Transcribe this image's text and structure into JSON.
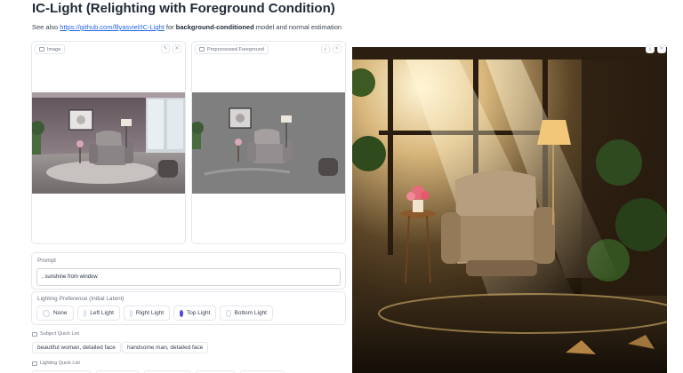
{
  "header": {
    "title": "IC-Light (Relighting with Foreground Condition)",
    "see_also_prefix": "See also ",
    "link_text": "https://github.com/lllyasviel/IC-Light",
    "see_also_middle": " for ",
    "see_also_bold": "background-conditioned",
    "see_also_suffix": " model and normal estimation"
  },
  "image_panel": {
    "label": "Image",
    "edit_icon": "pencil-icon",
    "close_icon": "close-icon"
  },
  "preprocessed_panel": {
    "label": "Preprocessed Foreground",
    "download_icon": "download-icon",
    "share_icon": "share-icon"
  },
  "output_panel": {
    "download_icon": "download-icon",
    "close_icon": "close-icon"
  },
  "prompt": {
    "label": "Prompt",
    "value": ", sunshine from window"
  },
  "lighting_preference": {
    "label": "Lighting Preference (Initial Latent)",
    "options": [
      "None",
      "Left Light",
      "Right Light",
      "Top Light",
      "Bottom Light"
    ],
    "selected": "Top Light"
  },
  "subject_quick_list": {
    "label": "Subject Quick List",
    "items": [
      "beautiful woman, detailed face",
      "handsome man, detailed face"
    ]
  },
  "lighting_quick_list": {
    "label": "Lighting Quick List"
  },
  "colors": {
    "accent": "#4f46e5",
    "link": "#2563eb",
    "border": "#e5e7eb"
  }
}
